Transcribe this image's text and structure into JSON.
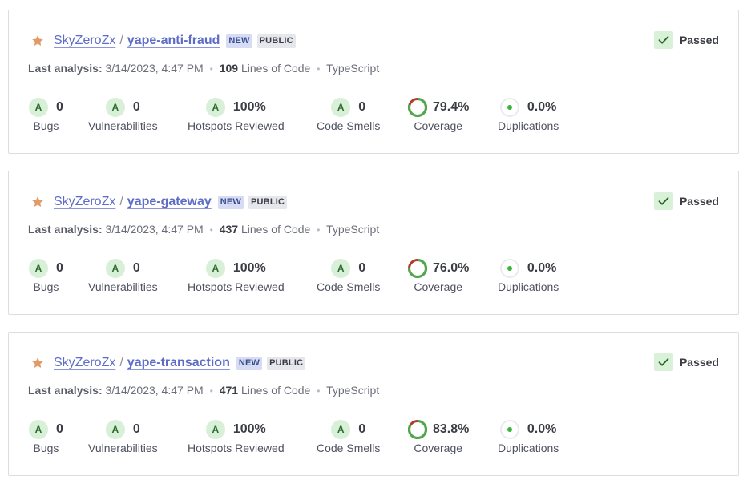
{
  "colors": {
    "accent": "#5d6cc6",
    "passed_bg": "#d9f1d9",
    "coverage_green": "#4bab4b",
    "coverage_red": "#b33a2e",
    "star": "#e19b69"
  },
  "labels": {
    "last_analysis": "Last analysis:",
    "lines_of_code": "Lines of Code",
    "language": "TypeScript",
    "new_badge": "NEW",
    "public_badge": "PUBLIC",
    "passed": "Passed",
    "bugs": "Bugs",
    "vulnerabilities": "Vulnerabilities",
    "hotspots": "Hotspots Reviewed",
    "code_smells": "Code Smells",
    "coverage": "Coverage",
    "duplications": "Duplications"
  },
  "projects": [
    {
      "owner": "SkyZeroZx",
      "separator": "/",
      "name": "yape-anti-fraud",
      "date": "3/14/2023, 4:47 PM",
      "loc": "109",
      "bugs": "0",
      "bugs_rating": "A",
      "vulns": "0",
      "vulns_rating": "A",
      "hotspots": "100%",
      "hotspots_rating": "A",
      "smells": "0",
      "smells_rating": "A",
      "coverage": "79.4%",
      "coverage_pct": 79.4,
      "duplications": "0.0%"
    },
    {
      "owner": "SkyZeroZx",
      "separator": "/",
      "name": "yape-gateway",
      "date": "3/14/2023, 4:47 PM",
      "loc": "437",
      "bugs": "0",
      "bugs_rating": "A",
      "vulns": "0",
      "vulns_rating": "A",
      "hotspots": "100%",
      "hotspots_rating": "A",
      "smells": "0",
      "smells_rating": "A",
      "coverage": "76.0%",
      "coverage_pct": 76.0,
      "duplications": "0.0%"
    },
    {
      "owner": "SkyZeroZx",
      "separator": "/",
      "name": "yape-transaction",
      "date": "3/14/2023, 4:47 PM",
      "loc": "471",
      "bugs": "0",
      "bugs_rating": "A",
      "vulns": "0",
      "vulns_rating": "A",
      "hotspots": "100%",
      "hotspots_rating": "A",
      "smells": "0",
      "smells_rating": "A",
      "coverage": "83.8%",
      "coverage_pct": 83.8,
      "duplications": "0.0%"
    }
  ],
  "icons": {
    "favorite": "star-icon",
    "gate": "check-icon"
  }
}
